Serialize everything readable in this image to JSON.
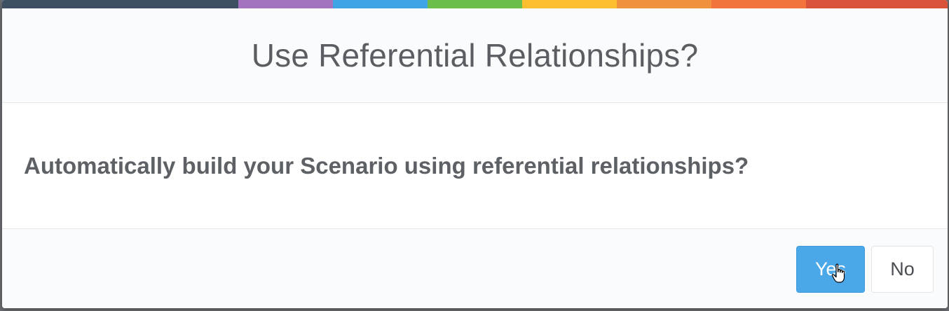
{
  "dialog": {
    "title": "Use Referential Relationships?",
    "message": "Automatically build your Scenario using referential relationships?",
    "yes_label": "Yes",
    "no_label": "No"
  },
  "colors": {
    "accent_bar": [
      "#3d4f63",
      "#a473bf",
      "#3fa4e3",
      "#6cbd49",
      "#fbbf2f",
      "#f0913d",
      "#f2733b",
      "#d9533b"
    ],
    "primary_button": "#4aa8e8"
  },
  "icons": {
    "cursor": "hand-pointer-icon"
  }
}
